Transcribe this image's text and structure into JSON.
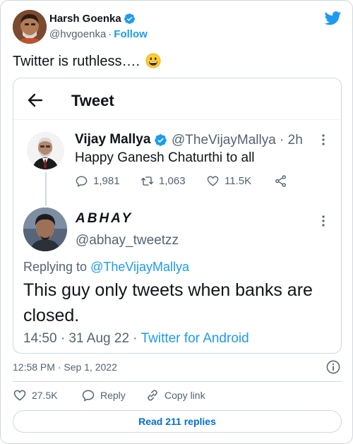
{
  "author": {
    "name": "Harsh Goenka",
    "handle": "@hvgoenka",
    "separator": "·",
    "follow_label": "Follow"
  },
  "tweet": {
    "text": "Twitter is ruthless….",
    "emoji": "grinning-face-emoji",
    "timestamp": "12:58 PM · Sep 1, 2022"
  },
  "embedded": {
    "header_title": "Tweet",
    "parent": {
      "name": "Vijay Mallya",
      "handle_time": "@TheVijayMallya · 2h",
      "text": "Happy Ganesh Chaturthi to all",
      "replies": "1,981",
      "retweets": "1,063",
      "likes": "11.5K"
    },
    "reply": {
      "name": "ABHAY",
      "handle": "@abhay_tweetzz",
      "replying_label": "Replying to ",
      "replying_to": "@TheVijayMallya",
      "text": "This guy only tweets when banks are closed.",
      "time_date": "14:50 · 31 Aug 22 · ",
      "source": "Twitter for Android"
    }
  },
  "actions": {
    "likes": "27.5K",
    "reply_label": "Reply",
    "copy_label": "Copy link"
  },
  "read_replies_label": "Read 211 replies",
  "colors": {
    "accent": "#1d9bf0",
    "text": "#0f1419",
    "muted": "#536471",
    "border": "#cfd9de",
    "button_text": "#006fd6"
  }
}
